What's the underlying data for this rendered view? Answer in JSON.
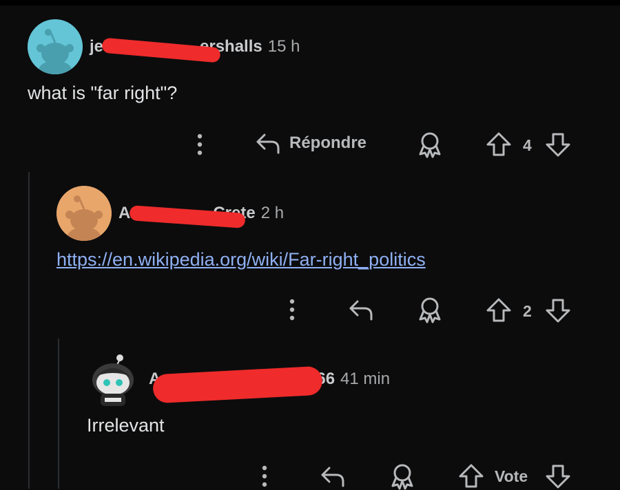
{
  "comments": [
    {
      "username": "je",
      "username_tail": "ershalls",
      "time": "15 h",
      "body": "what is \"far right\"?",
      "reply_label": "Répondre",
      "score": "4"
    },
    {
      "username": "A",
      "username_tail": "Crete",
      "time": "2 h",
      "link": "https://en.wikipedia.org/wiki/Far-right_politics",
      "score": "2"
    },
    {
      "username": "A",
      "username_tail": "66",
      "time": "41 min",
      "body": "Irrelevant",
      "vote_label": "Vote"
    }
  ],
  "colors": {
    "background": "#0c0c0d",
    "link": "#8fb0f2",
    "redaction": "#ef2b2b",
    "avatar_1": "#63c5d6",
    "avatar_2": "#e8a66b"
  },
  "icons": [
    "snoo-avatar",
    "more-dots-icon",
    "reply-arrow-icon",
    "award-icon",
    "upvote-icon",
    "downvote-icon"
  ]
}
